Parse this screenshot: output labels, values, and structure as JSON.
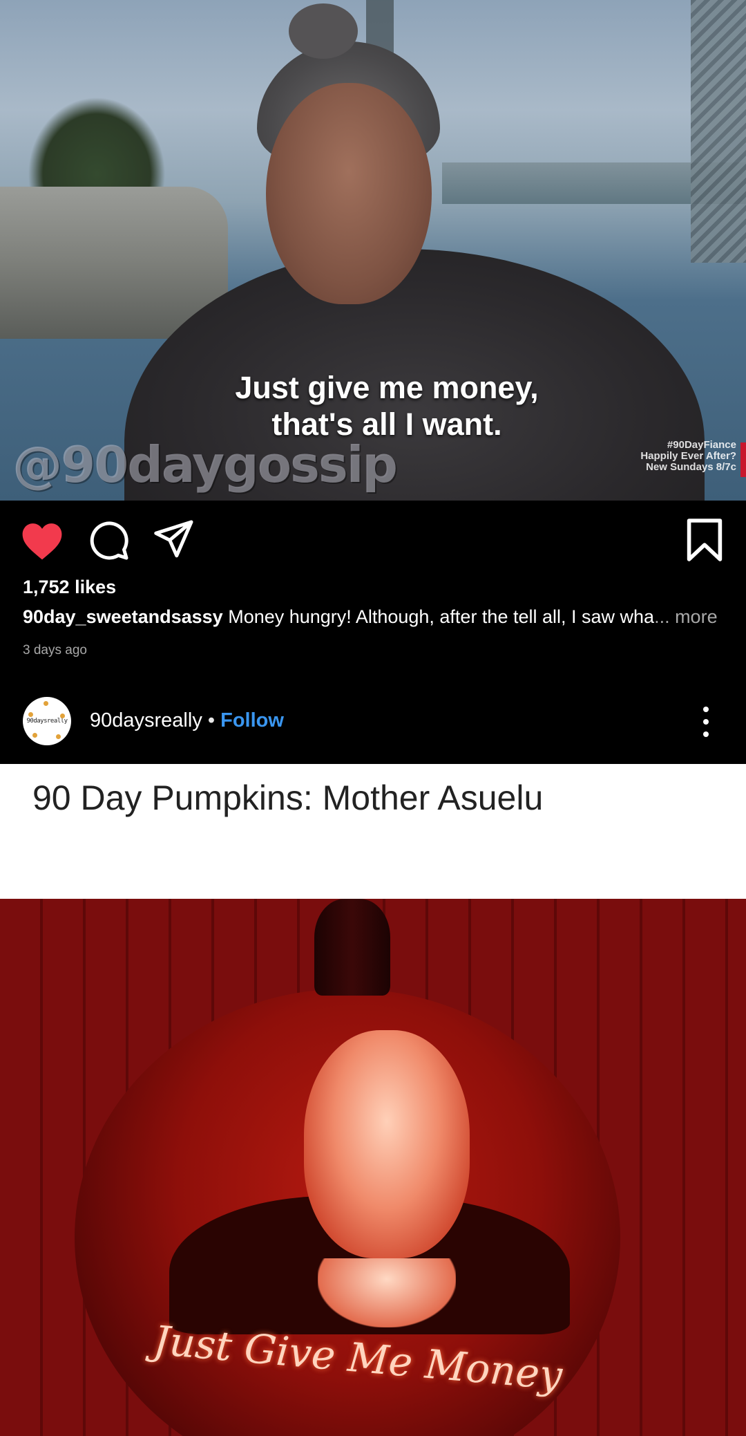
{
  "post1": {
    "image_caption_line1": "Just give me money,",
    "image_caption_line2": "that's all I want.",
    "watermark": "@90daygossip",
    "show_tag_line1": "#90DayFiance",
    "show_tag_line2": "Happily Ever After?",
    "show_tag_line3": "New Sundays 8/7c",
    "likes": "1,752 likes",
    "caption_user": "90day_sweetandsassy",
    "caption_text": " Money hungry! Although, after the tell all, I saw wha",
    "caption_more": "... more",
    "time": "3 days ago",
    "liked": true,
    "icons": [
      "heart-icon",
      "comment-icon",
      "share-icon",
      "bookmark-icon"
    ],
    "colors": {
      "like": "#f23a4d"
    }
  },
  "post2": {
    "avatar_text": "90daysreally",
    "username": "90daysreally",
    "separator": " • ",
    "follow_label": "Follow",
    "title": "90 Day Pumpkins: Mother Asuelu",
    "pumpkin_text": "Just Give Me Money",
    "colors": {
      "follow": "#3a96f0"
    }
  }
}
